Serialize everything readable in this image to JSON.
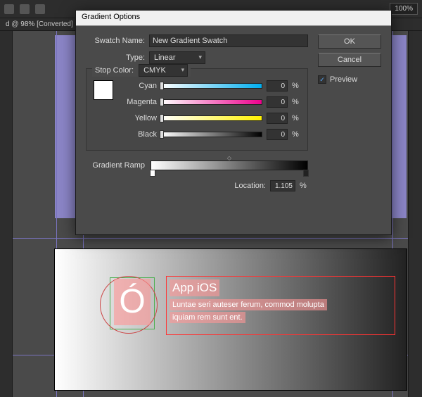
{
  "app": {
    "zoom": "100%",
    "docTab": "d @ 98% [Converted]"
  },
  "dialog": {
    "title": "Gradient Options",
    "swatchNameLabel": "Swatch Name:",
    "swatchName": "New Gradient Swatch",
    "typeLabel": "Type:",
    "type": "Linear",
    "stopColorLabel": "Stop Color:",
    "stopColor": "CMYK",
    "channels": {
      "cyan": {
        "label": "Cyan",
        "value": "0"
      },
      "magenta": {
        "label": "Magenta",
        "value": "0"
      },
      "yellow": {
        "label": "Yellow",
        "value": "0"
      },
      "black": {
        "label": "Black",
        "value": "0"
      }
    },
    "pct": "%",
    "rampLabel": "Gradient Ramp",
    "locationLabel": "Location:",
    "location": "1.105",
    "buttons": {
      "ok": "OK",
      "cancel": "Cancel"
    },
    "previewLabel": "Preview",
    "previewChecked": "✓"
  },
  "mock": {
    "title": "App iOS",
    "line1": "Luntae seri auteser ferum, commod molupta",
    "line2": "iquiam rem sunt ent.",
    "glyph": "Ó"
  }
}
